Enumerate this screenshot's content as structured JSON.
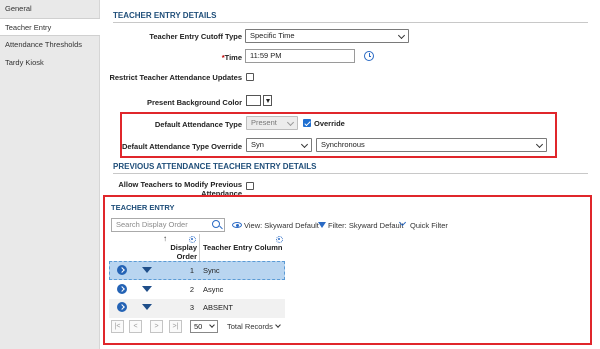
{
  "sidebar": {
    "items": [
      {
        "label": "General"
      },
      {
        "label": "Teacher Entry"
      },
      {
        "label": "Attendance Thresholds"
      },
      {
        "label": "Tardy Kiosk"
      }
    ]
  },
  "details": {
    "title": "TEACHER ENTRY DETAILS",
    "cutoff_type_label": "Teacher Entry Cutoff Type",
    "cutoff_type_value": "Specific Time",
    "time_required": "*",
    "time_label": "Time",
    "time_value": "11:59 PM",
    "restrict_label": "Restrict Teacher Attendance Updates",
    "background_label": "Present Background Color",
    "default_type_label": "Default Attendance Type",
    "default_type_value": "Present",
    "override_label": "Override",
    "override_type_label": "Default Attendance Type Override",
    "override_code_value": "Syn",
    "override_desc_value": "Synchronous"
  },
  "previous": {
    "title": "PREVIOUS ATTENDANCE TEACHER ENTRY DETAILS",
    "allow_label_line1": "Allow Teachers to Modify Previous",
    "allow_label_line2": "Attendance"
  },
  "grid": {
    "title": "TEACHER ENTRY",
    "search_placeholder": "Search Display Order",
    "view_label": "View: Skyward Default",
    "filter_label": "Filter: Skyward Default",
    "quick_filter_label": "Quick Filter",
    "col_order_line1": "Display",
    "col_order_line2": "Order",
    "col_entry": "Teacher Entry Column",
    "rows": [
      {
        "order": "1",
        "column": "Sync"
      },
      {
        "order": "2",
        "column": "Async"
      },
      {
        "order": "3",
        "column": "ABSENT"
      }
    ],
    "pager": {
      "first": "|<",
      "prev": "<",
      "next": ">",
      "last": ">|",
      "page_size": "50",
      "total_label": "Total Records"
    }
  },
  "colors": {
    "accent": "#1f4e79",
    "highlight_box": "#e0262b",
    "selected_row": "#b9d5f0",
    "checkbox_checked": "#1f6fd1"
  }
}
